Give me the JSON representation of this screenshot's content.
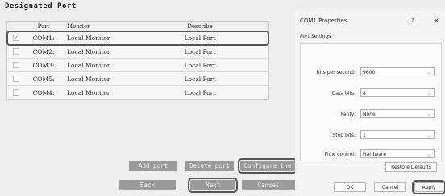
{
  "wizard": {
    "title": "Designated Port",
    "columns": {
      "port": "Port",
      "monitor": "Monitor",
      "describe": "Describe"
    },
    "rows": [
      {
        "checked": true,
        "port": "COM1:",
        "monitor": "Local Monitor",
        "describe": "Local Port"
      },
      {
        "checked": false,
        "port": "COM2:",
        "monitor": "Local Monitor",
        "describe": "Local Port"
      },
      {
        "checked": false,
        "port": "COM3:",
        "monitor": "Local Monitor",
        "describe": "Local Port"
      },
      {
        "checked": false,
        "port": "COM5:",
        "monitor": "Local Monitor",
        "describe": "Local Port"
      },
      {
        "checked": false,
        "port": "COM4:",
        "monitor": "Local Monitor",
        "describe": "Local Port"
      }
    ],
    "buttons": {
      "add": "Add port",
      "delete": "Delete port",
      "configure": "Configure the port",
      "back": "Back",
      "next": "Next",
      "cancel": "Cancel"
    }
  },
  "dialog": {
    "title": "COM1 Properties",
    "help": "?",
    "close": "×",
    "tab": "Port Settings",
    "fields": {
      "bits_per_second": {
        "label": "Bits per second:",
        "value": "9600"
      },
      "data_bits": {
        "label": "Data bits:",
        "value": "8"
      },
      "parity": {
        "label": "Parity:",
        "value": "None"
      },
      "stop_bits": {
        "label": "Stop bits:",
        "value": "1"
      },
      "flow_control": {
        "label": "Flow control:",
        "value": "Hardware"
      }
    },
    "buttons": {
      "restore": "Restore Defaults",
      "ok": "OK",
      "cancel": "Cancel",
      "apply": "Apply"
    }
  },
  "colors": {
    "accent_border": "#555555",
    "button_bg": "#9a9a9a"
  }
}
